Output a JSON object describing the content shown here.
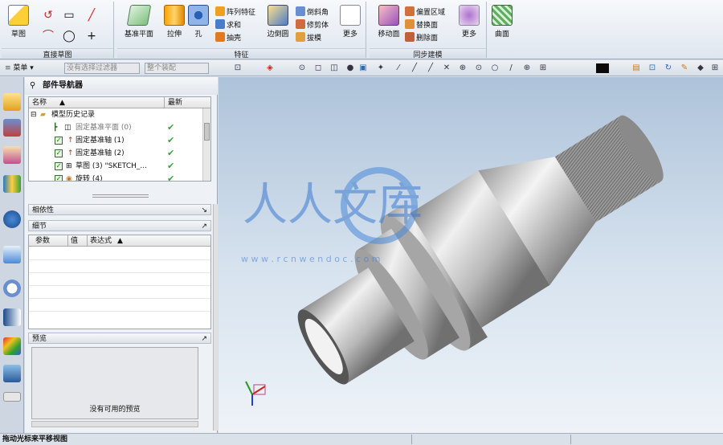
{
  "ribbon": {
    "sketch_label": "草图",
    "direct_sketch_group": "直接草图",
    "datum_plane": "基准平面",
    "extrude": "拉伸",
    "hole": "孔",
    "pattern_feature": "阵列特征",
    "unite": "求和",
    "shell": "抽壳",
    "edge_blend": "边倒圆",
    "chamfer": "倒斜角",
    "trim_body": "修剪体",
    "draft": "拔模",
    "more_feature": "更多",
    "feature_group": "特征",
    "move_face": "移动面",
    "offset_region": "偏置区域",
    "replace_face": "替换面",
    "delete_face": "删除面",
    "more_sync": "更多",
    "sync_group": "同步建模",
    "surface": "曲面"
  },
  "toolbar2": {
    "menu": "菜单",
    "filter_placeholder": "没有选择过滤器",
    "assembly_placeholder": "整个装配"
  },
  "navigator": {
    "title": "部件导航器",
    "col_name": "名称",
    "col_latest": "最新",
    "history": "模型历史记录",
    "rows": [
      {
        "label": "固定基准平面 (0)",
        "checked": true
      },
      {
        "label": "固定基准轴 (1)",
        "checked": true
      },
      {
        "label": "固定基准轴 (2)",
        "checked": true
      },
      {
        "label": "草图 (3) \"SKETCH_...",
        "checked": true
      },
      {
        "label": "旋转 (4)",
        "checked": true
      }
    ],
    "dependencies": "相依性",
    "details": "细节",
    "details_cols": [
      "参数",
      "值",
      "表达式"
    ],
    "preview": "预览",
    "preview_empty": "没有可用的预览"
  },
  "watermark": {
    "text": "人人文库",
    "url": "w w w . r c n w e n d o c . c o m"
  },
  "status": {
    "message": "拖动光标来平移视图"
  },
  "colors": {
    "ribbon_bg": "#e6ebf2",
    "viewport_top": "#aec3da",
    "viewport_bottom": "#eef3f8",
    "part_gray": "#b9b9b9",
    "check_green": "#3ca33a"
  }
}
